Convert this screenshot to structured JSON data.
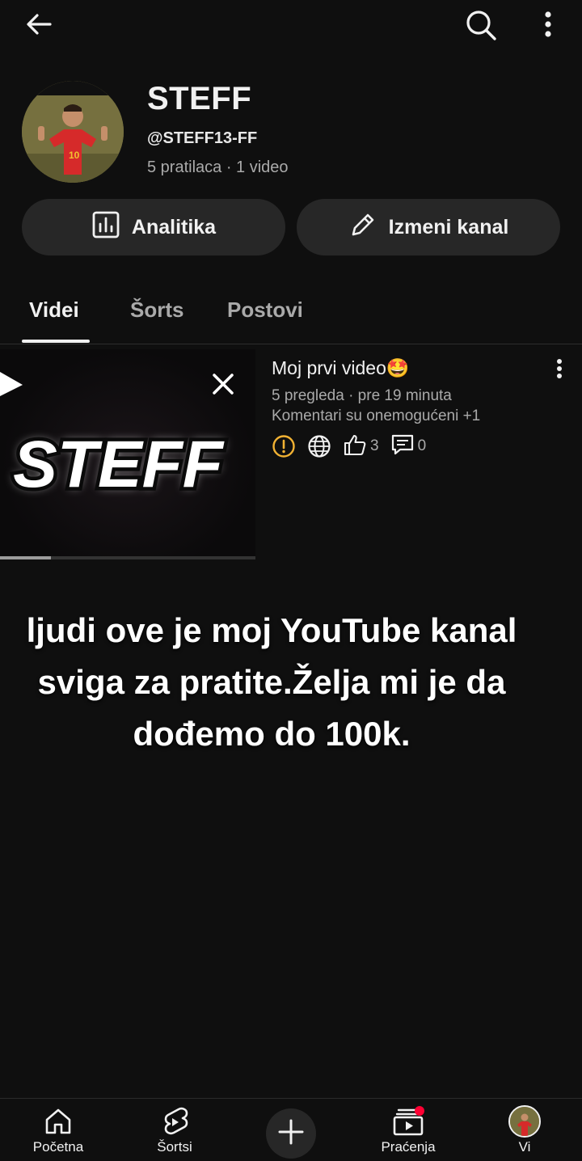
{
  "channel": {
    "name": "STEFF",
    "handle": "@STEFF13-FF",
    "stats": "5 pratilaca · 1 video"
  },
  "actions": {
    "analytics_label": "Analitika",
    "edit_label": "Izmeni kanal"
  },
  "tabs": [
    {
      "label": "Videi",
      "active": true
    },
    {
      "label": "Šorts",
      "active": false
    },
    {
      "label": "Postovi",
      "active": false
    }
  ],
  "video": {
    "thumbnail_text": "STEFF",
    "title": "Moj prvi video🤩",
    "meta_views": "5 pregleda · pre 19 minuta",
    "meta_comments": "Komentari su onemogućeni +1",
    "likes": "3",
    "comments": "0",
    "progress_fraction": 0.2
  },
  "caption": {
    "line1": "ljudi ove je moj YouTube kanal",
    "line2": "sviga za pratite.Želja mi je da",
    "line3": "dođemo do 100k."
  },
  "bottom_nav": {
    "home": "Početna",
    "shorts": "Šortsi",
    "subscriptions": "Praćenja",
    "you": "Vi"
  },
  "colors": {
    "background": "#0f0f0f",
    "button": "#272727",
    "warning": "#f2b233",
    "notification": "#ff0033"
  },
  "icons": [
    "back-arrow-icon",
    "search-icon",
    "more-vert-icon",
    "analytics-icon",
    "pencil-icon",
    "play-icon",
    "close-icon",
    "warning-icon",
    "globe-icon",
    "thumbs-up-icon",
    "comment-icon",
    "home-icon",
    "shorts-icon",
    "plus-icon",
    "subscriptions-icon"
  ]
}
